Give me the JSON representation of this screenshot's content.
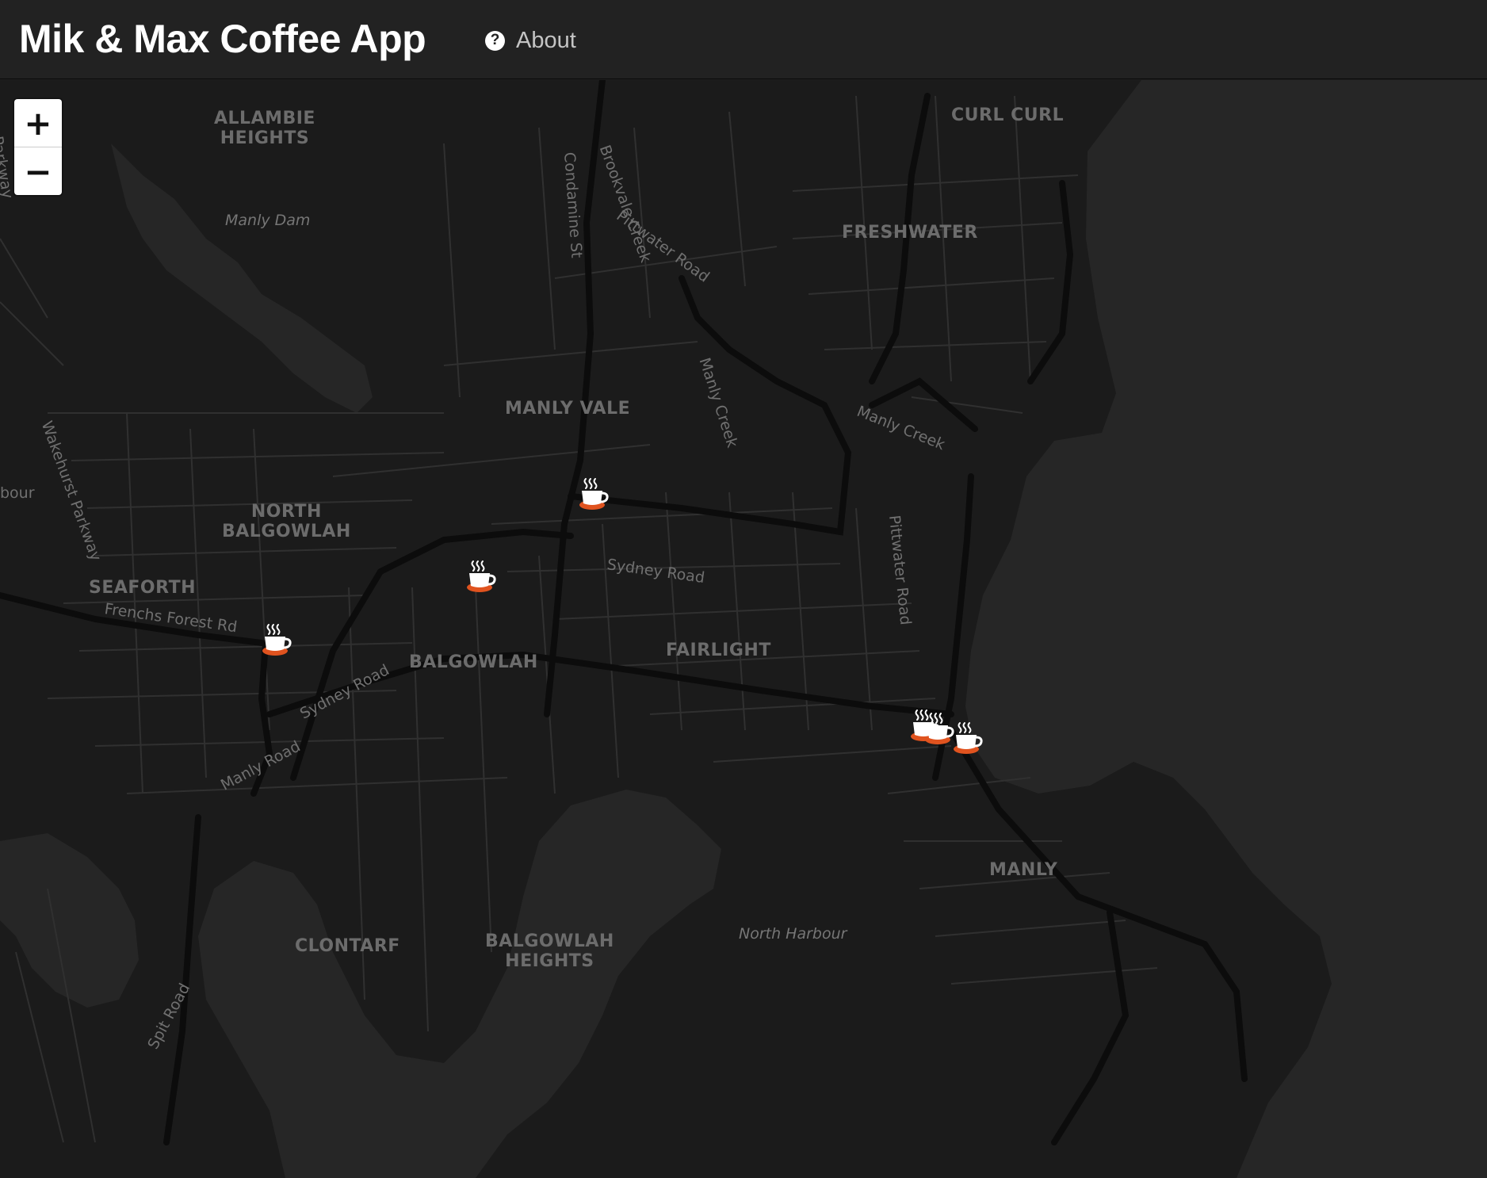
{
  "navbar": {
    "brand": "Mik & Max Coffee App",
    "about_label": "About",
    "about_icon": "question-circle-icon"
  },
  "map": {
    "zoom_in_label": "+",
    "zoom_out_label": "−",
    "marker_icon": "coffee-cup-icon",
    "colors": {
      "land": "#1b1b1b",
      "water": "#262626",
      "roads": "#333333",
      "major_roads": "#0c0c0c",
      "labels": "#6c6c6c",
      "marker_cup": "#ffffff",
      "marker_base": "#e0531f"
    },
    "places": {
      "allambie_heights": "ALLAMBIE\nHEIGHTS",
      "curl_curl": "CURL CURL",
      "freshwater": "FRESHWATER",
      "manly_vale": "MANLY VALE",
      "north_balgowlah": "NORTH\nBALGOWLAH",
      "seaforth": "SEAFORTH",
      "fairlight": "FAIRLIGHT",
      "balgowlah": "BALGOWLAH",
      "manly": "MANLY",
      "clontarf": "CLONTARF",
      "balgowlah_heights": "BALGOWLAH\nHEIGHTS"
    },
    "streets": {
      "condamine": "Condamine St",
      "brookvale_creek": "Brookvale Creek",
      "pittwater_road_north": "Pittwater Road",
      "manly_creek_1": "Manly Creek",
      "manly_creek_2": "Manly Creek",
      "pittwater_road_south": "Pittwater Road",
      "wakehurst": "Wakehurst Parkway",
      "frenchs_forest": "Frenchs Forest Rd",
      "sydney_road_west": "Sydney Road",
      "sydney_road_east": "Sydney Road",
      "manly_road": "Manly Road",
      "spit_road": "Spit Road",
      "parkway_edge": "Parkway",
      "harbour_edge": "bour"
    },
    "water_labels": {
      "manly_dam": "Manly Dam",
      "north_harbour": "North Harbour"
    }
  }
}
